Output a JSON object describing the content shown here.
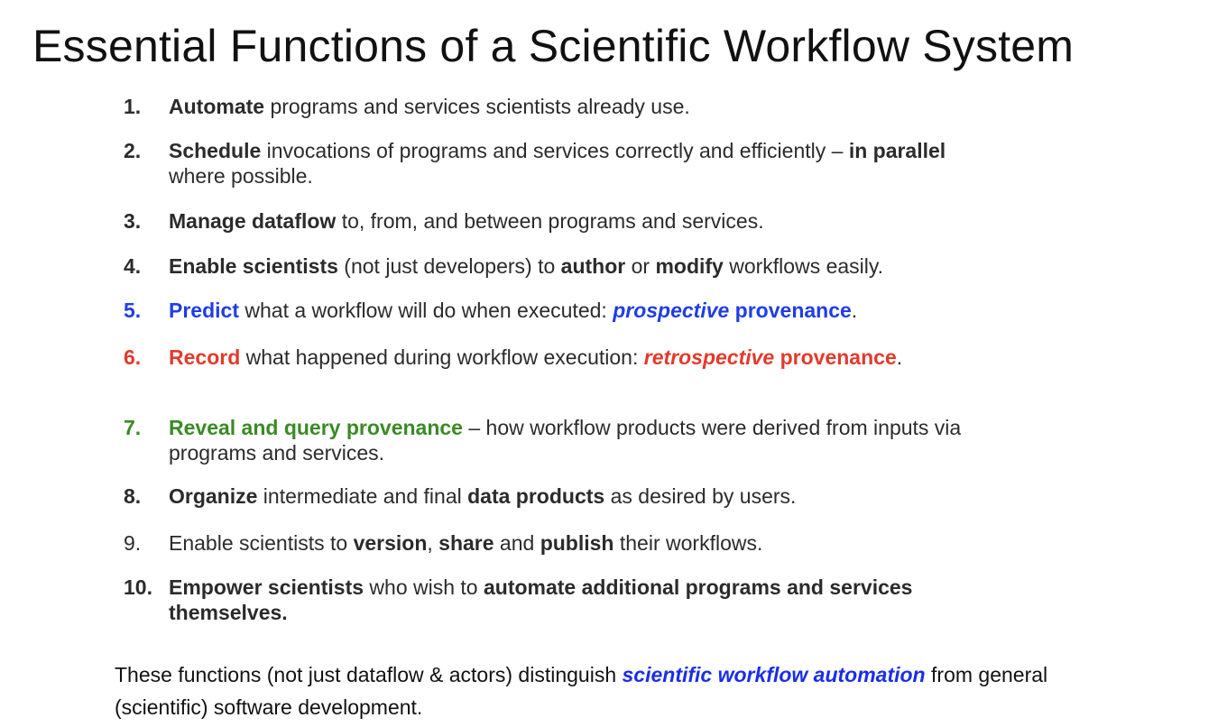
{
  "slide": {
    "title": "Essential Functions of a Scientific Workflow System"
  },
  "colors": {
    "text": "#2b2b2b",
    "blue": "#1f3de6",
    "red": "#e23a2b",
    "green": "#3a8a25",
    "accent_blue": "#1a2ee8"
  },
  "items": [
    {
      "num": "1.",
      "segments": [
        "Automate",
        " programs and services scientists already use."
      ]
    },
    {
      "num": "2.",
      "segments": [
        "Schedule",
        " invocations of programs and services correctly and efficiently – ",
        "in parallel",
        " where possible."
      ]
    },
    {
      "num": "3.",
      "segments": [
        "Manage dataflow",
        " to, from, and between programs and services."
      ]
    },
    {
      "num": "4.",
      "segments": [
        "Enable scientists",
        " (not just developers) to ",
        "author",
        " or ",
        "modify",
        " workflows easily."
      ]
    },
    {
      "num": "5.",
      "segments": [
        "Predict",
        " what a workflow will do when executed: ",
        "prospective",
        " provenance",
        "."
      ]
    },
    {
      "num": "6.",
      "segments": [
        "Record",
        " what happened during workflow execution: ",
        "retrospective",
        " provenance",
        "."
      ]
    },
    {
      "num": "7.",
      "segments": [
        "Reveal and query provenance",
        " – how workflow products were derived from inputs via programs and services."
      ]
    },
    {
      "num": "8.",
      "segments": [
        "Organize",
        " intermediate and final ",
        "data products",
        " as desired by users."
      ]
    },
    {
      "num": "9.",
      "segments": [
        "Enable scientists to ",
        "version",
        ", ",
        "share",
        " and ",
        "publish",
        " their workflows."
      ]
    },
    {
      "num": "10.",
      "segments": [
        "Empower scientists",
        " who wish to ",
        "automate additional programs and services themselves."
      ]
    }
  ],
  "footer": {
    "before": "These functions (not just dataflow & actors) distinguish ",
    "highlight": "scientific workflow automation",
    "after": " from general (scientific) software development."
  }
}
